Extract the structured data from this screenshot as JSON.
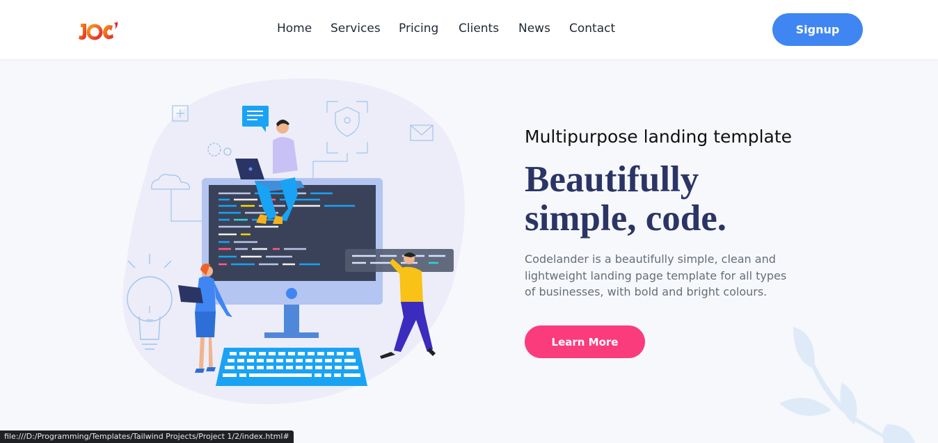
{
  "header": {
    "logo_text": "JOE",
    "nav": [
      "Home",
      "Services",
      "Pricing",
      "Clients",
      "News",
      "Contact"
    ],
    "signup_label": "Signup"
  },
  "hero": {
    "subtitle": "Multipurpose landing template",
    "title_line1": "Beautifully",
    "title_line2": "simple, code.",
    "description": "Codelander is a beautifully simple, clean and lightweight landing page template for all types of businesses, with bold and bright colours.",
    "cta_label": "Learn More"
  },
  "status_bar": {
    "url": "file:///D:/Programming/Templates/Tailwind Projects/Project 1/2/index.html#"
  },
  "colors": {
    "primary": "#3f86f3",
    "accent": "#fb3c7c",
    "title": "#2b3565"
  }
}
